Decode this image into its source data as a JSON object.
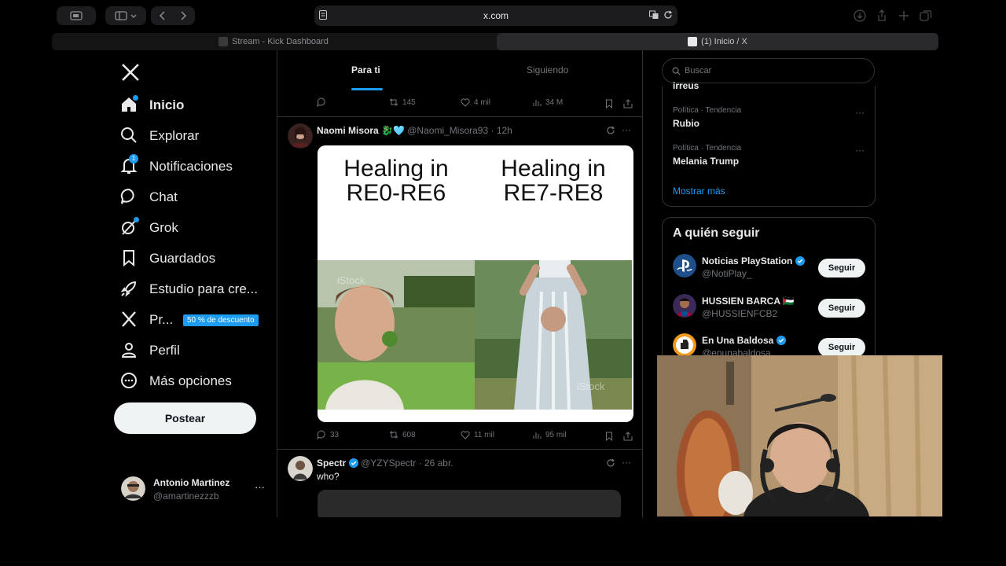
{
  "browser": {
    "url": "x.com",
    "tabs": [
      {
        "title": "Stream - Kick Dashboard"
      },
      {
        "title": "(1) Inicio / X"
      }
    ]
  },
  "nav": {
    "items": [
      {
        "label": "Inicio",
        "icon": "home-icon"
      },
      {
        "label": "Explorar",
        "icon": "search-icon"
      },
      {
        "label": "Notificaciones",
        "icon": "bell-icon",
        "badge": "1"
      },
      {
        "label": "Chat",
        "icon": "chat-icon"
      },
      {
        "label": "Grok",
        "icon": "grok-icon"
      },
      {
        "label": "Guardados",
        "icon": "bookmark-icon"
      },
      {
        "label": "Estudio para cre...",
        "icon": "rocket-icon"
      },
      {
        "label": "Pr...",
        "icon": "x-premium-icon",
        "discount": "50 % de descuento"
      },
      {
        "label": "Perfil",
        "icon": "person-icon"
      },
      {
        "label": "Más opciones",
        "icon": "more-circle-icon"
      }
    ],
    "post_button": "Postear",
    "profile": {
      "name": "Antonio Martinez",
      "handle": "@amartinezzzb",
      "more": "···"
    }
  },
  "feed": {
    "tabs": [
      {
        "label": "Para ti"
      },
      {
        "label": "Siguiendo"
      }
    ],
    "prev_stats": {
      "retweets": "145",
      "likes": "4 mil",
      "views": "34 M"
    },
    "tweet1": {
      "name": "Naomi Misora 🐉🩵",
      "handle": "@Naomi_Misora93",
      "time": "12h",
      "meme_left": "Healing in\nRE0-RE6",
      "meme_right": "Healing in\nRE7-RE8",
      "watermark": "iStock",
      "stats": {
        "replies": "33",
        "retweets": "608",
        "likes": "11 mil",
        "views": "95 mil"
      }
    },
    "tweet2": {
      "name": "Spectr",
      "handle": "@YZYSpectr",
      "time": "26 abr.",
      "text": "who?"
    }
  },
  "sidebar": {
    "search_placeholder": "Buscar",
    "trends_cut": "irreus",
    "trends": [
      {
        "category": "Política · Tendencia",
        "title": "Rubio"
      },
      {
        "category": "Política · Tendencia",
        "title": "Melania Trump"
      }
    ],
    "show_more": "Mostrar más",
    "who_to_follow": {
      "title": "A quién seguir",
      "follow_label": "Seguir",
      "accounts": [
        {
          "name": "Noticias PlayStation",
          "handle": "@NotiPlay_",
          "verified": true
        },
        {
          "name": "HUSSIEN BARCA 🇵🇸",
          "handle": "@HUSSIENFCB2",
          "verified": false
        },
        {
          "name": "En Una Baldosa",
          "handle": "@enunabaldosa",
          "verified": true
        }
      ]
    }
  },
  "colors": {
    "accent": "#1d9bf0",
    "background": "#000000",
    "border": "#2f3336",
    "muted": "#71767b"
  }
}
